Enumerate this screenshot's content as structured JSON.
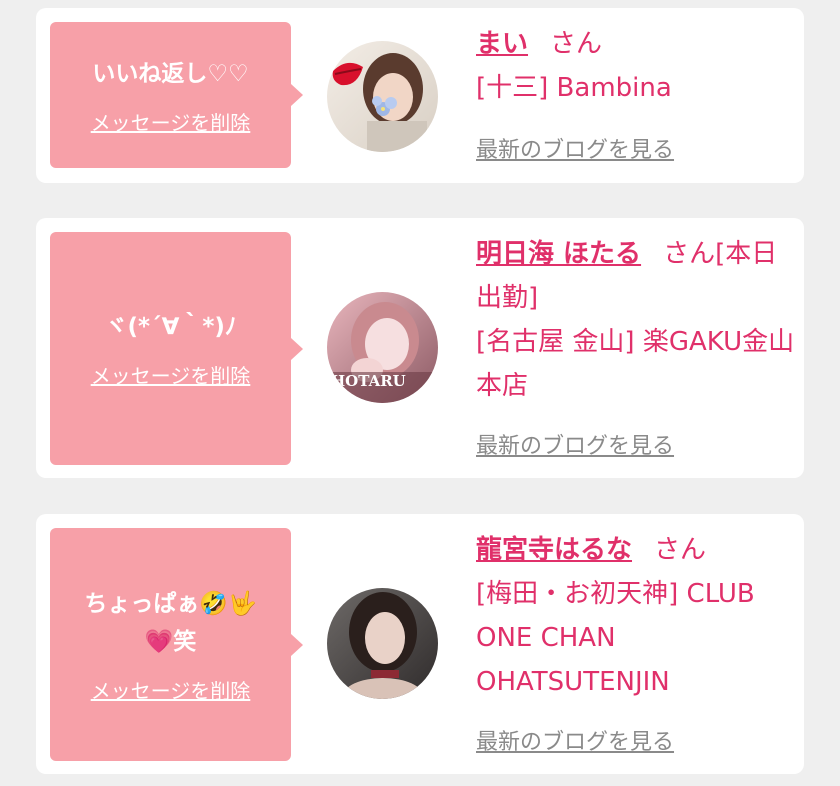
{
  "items": [
    {
      "message": "いいね返し♡♡",
      "delete_label": "メッセージを削除",
      "name": "まい",
      "honorific": "さん",
      "shop": "[十三] Bambina",
      "blog_label": "最新のブログを見る"
    },
    {
      "message": "ヾ(*´∀｀*)ﾉ",
      "delete_label": "メッセージを削除",
      "name": "明日海 ほたる",
      "honorific": "さん[本日出勤]",
      "shop": "[名古屋 金山] 楽GAKU金山本店",
      "blog_label": "最新のブログを見る",
      "avatar_text": "HOTARU"
    },
    {
      "message": "ちょっぱぁ🤣🤟💗笑",
      "delete_label": "メッセージを削除",
      "name": "龍宮寺はるな",
      "honorific": "さん",
      "shop": "[梅田・お初天神] CLUB ONE CHAN OHATSUTENJIN",
      "blog_label": "最新のブログを見る"
    }
  ]
}
